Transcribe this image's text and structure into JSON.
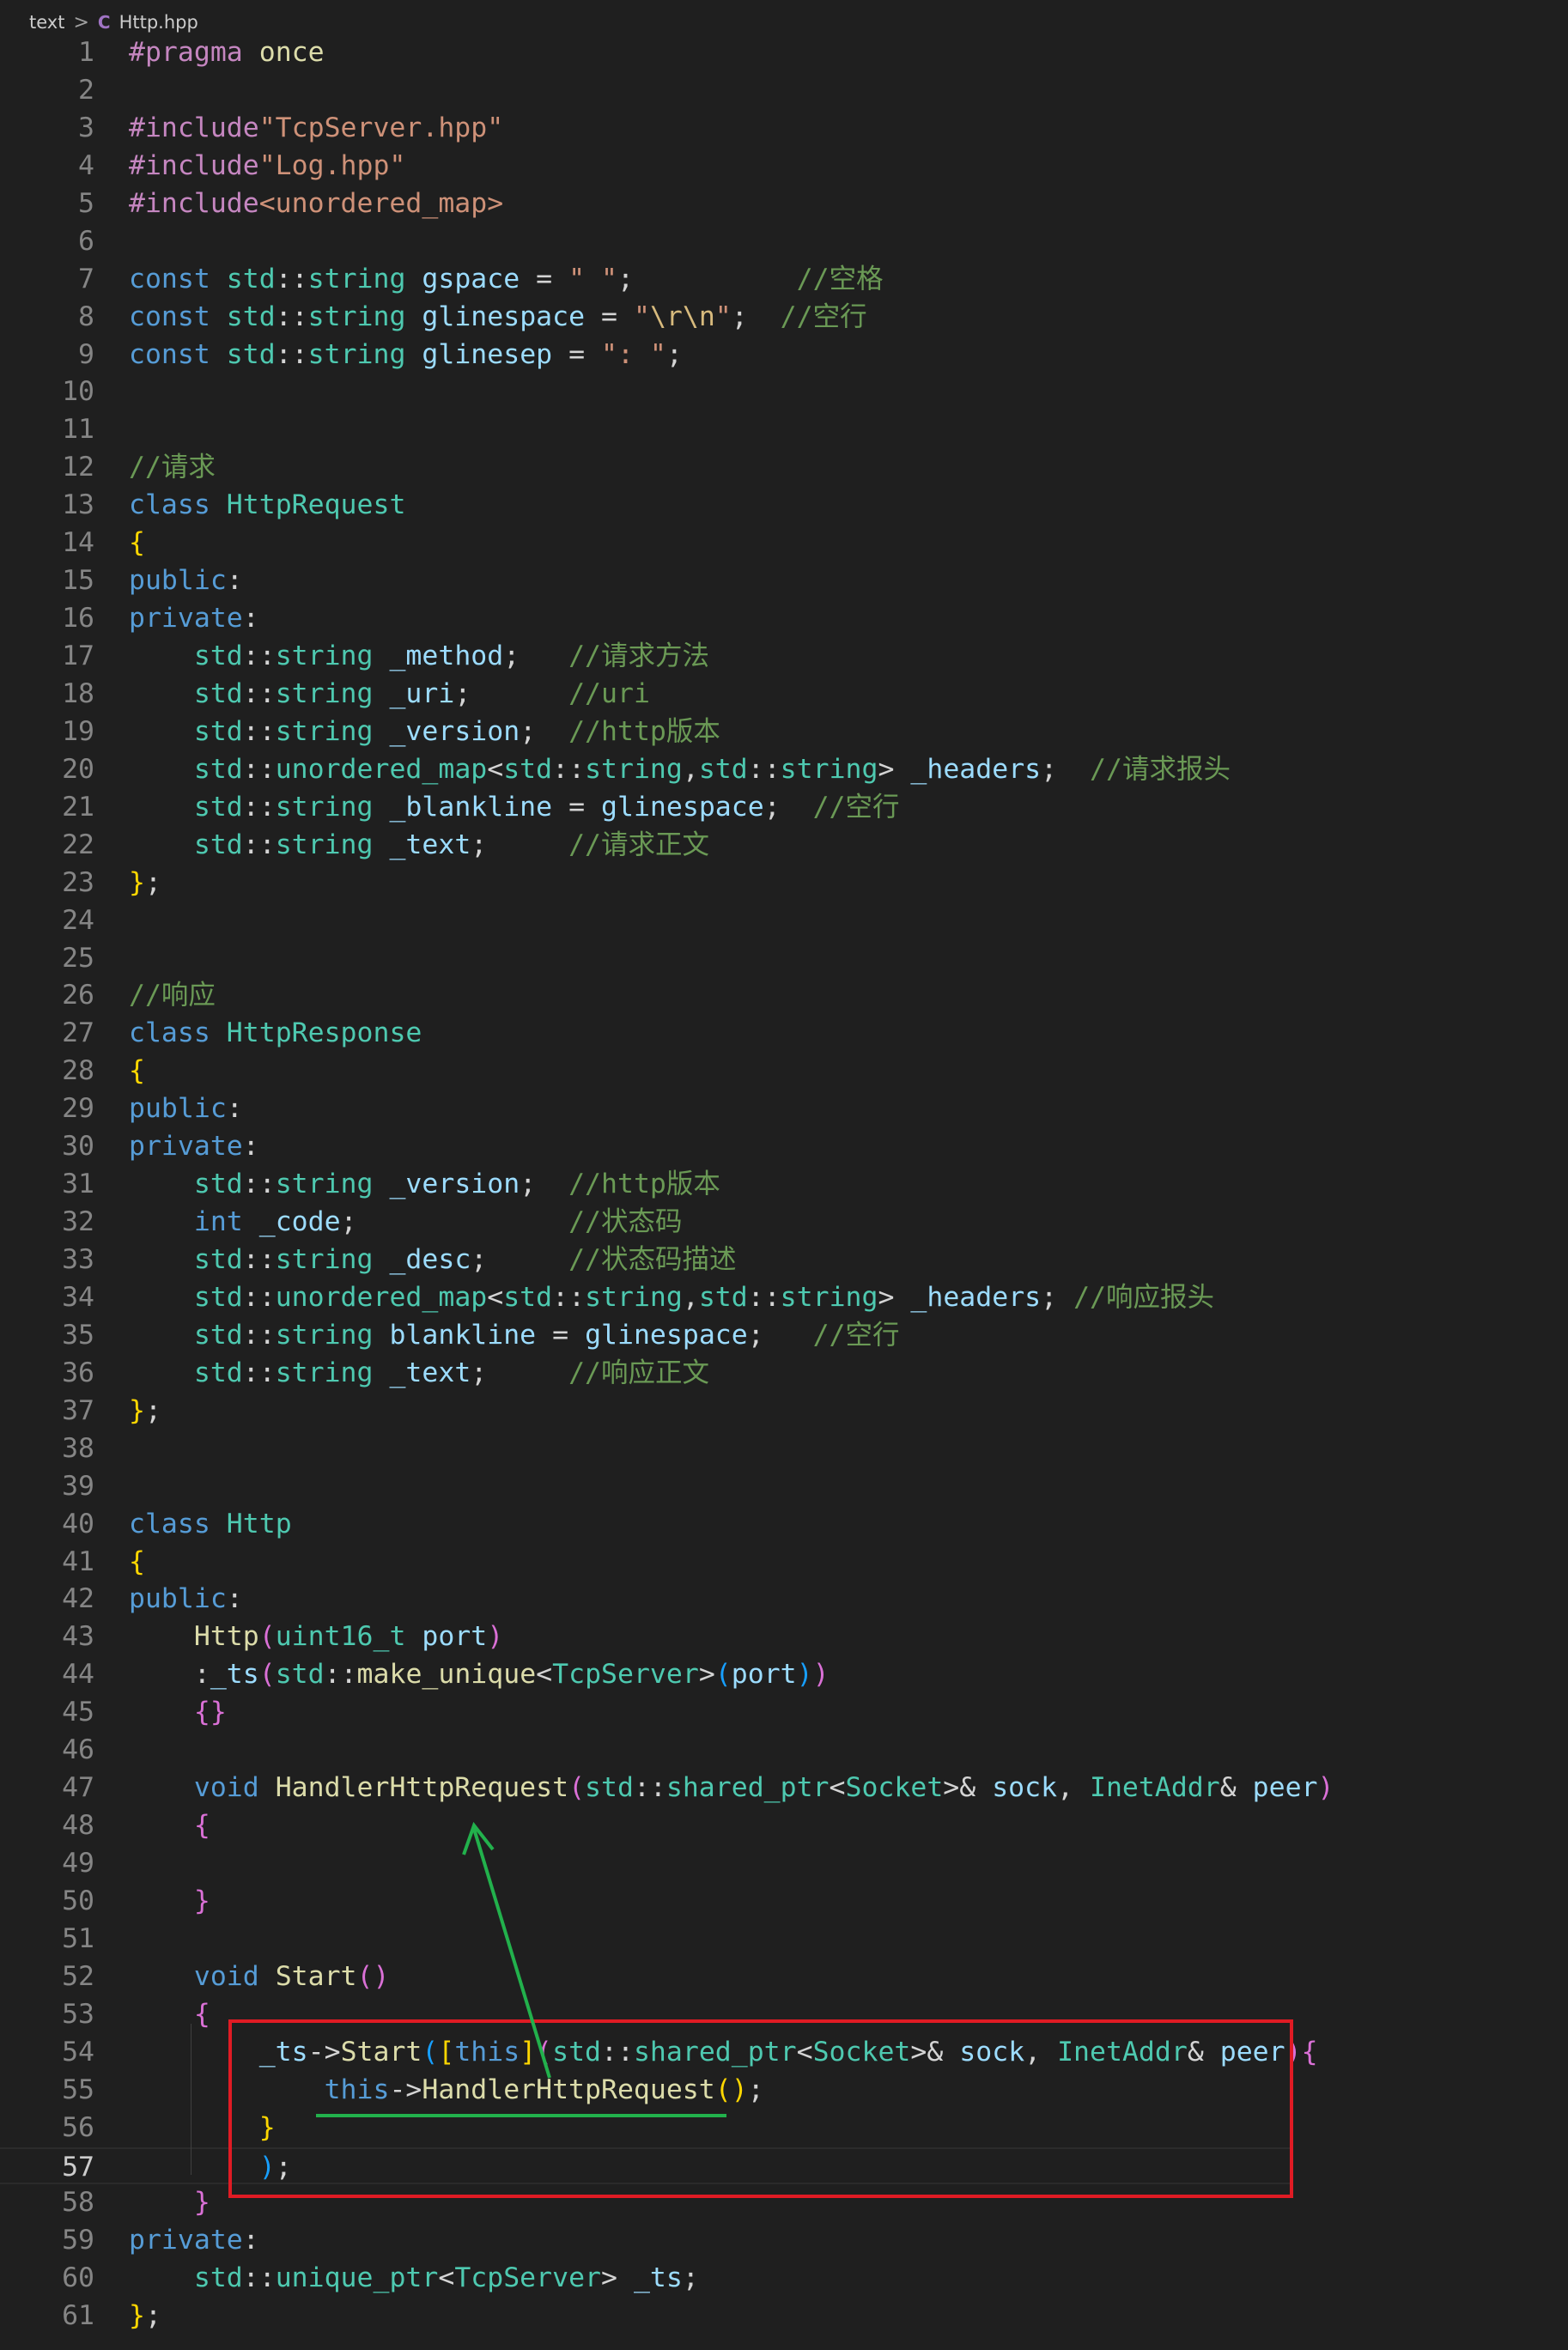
{
  "breadcrumb": {
    "folder": "text",
    "separator": ">",
    "file": "Http.hpp",
    "file_icon": "cpp-file-icon"
  },
  "editor": {
    "active_line": 57,
    "highlight_lines": [
      54,
      57
    ],
    "arrow": {
      "from_line": 55,
      "to_line": 47,
      "color": "#22b14c"
    },
    "box_color": "#e01b24"
  },
  "lines": [
    [
      [
        "pp",
        "#pragma"
      ],
      [
        "pl",
        " "
      ],
      [
        "fn",
        "once"
      ]
    ],
    [],
    [
      [
        "pp",
        "#include"
      ],
      [
        "str",
        "\"TcpServer.hpp\""
      ]
    ],
    [
      [
        "pp",
        "#include"
      ],
      [
        "str",
        "\"Log.hpp\""
      ]
    ],
    [
      [
        "pp",
        "#include"
      ],
      [
        "str",
        "<unordered_map>"
      ]
    ],
    [],
    [
      [
        "kw",
        "const"
      ],
      [
        "pl",
        " "
      ],
      [
        "ty",
        "std"
      ],
      [
        "pl",
        "::"
      ],
      [
        "ty",
        "string"
      ],
      [
        "pl",
        " "
      ],
      [
        "var",
        "gspace"
      ],
      [
        "pl",
        " = "
      ],
      [
        "str",
        "\" \""
      ],
      [
        "pl",
        ";          "
      ],
      [
        "cm",
        "//空格"
      ]
    ],
    [
      [
        "kw",
        "const"
      ],
      [
        "pl",
        " "
      ],
      [
        "ty",
        "std"
      ],
      [
        "pl",
        "::"
      ],
      [
        "ty",
        "string"
      ],
      [
        "pl",
        " "
      ],
      [
        "var",
        "glinespace"
      ],
      [
        "pl",
        " = "
      ],
      [
        "str",
        "\""
      ],
      [
        "esc",
        "\\r\\n"
      ],
      [
        "str",
        "\""
      ],
      [
        "pl",
        ";  "
      ],
      [
        "cm",
        "//空行"
      ]
    ],
    [
      [
        "kw",
        "const"
      ],
      [
        "pl",
        " "
      ],
      [
        "ty",
        "std"
      ],
      [
        "pl",
        "::"
      ],
      [
        "ty",
        "string"
      ],
      [
        "pl",
        " "
      ],
      [
        "var",
        "glinesep"
      ],
      [
        "pl",
        " = "
      ],
      [
        "str",
        "\": \""
      ],
      [
        "pl",
        ";"
      ]
    ],
    [],
    [],
    [
      [
        "cm",
        "//请求"
      ]
    ],
    [
      [
        "kw",
        "class"
      ],
      [
        "pl",
        " "
      ],
      [
        "ty",
        "HttpRequest"
      ]
    ],
    [
      [
        "b1",
        "{"
      ]
    ],
    [
      [
        "kw",
        "public"
      ],
      [
        "pl",
        ":"
      ]
    ],
    [
      [
        "kw",
        "private"
      ],
      [
        "pl",
        ":"
      ]
    ],
    [
      [
        "pl",
        "    "
      ],
      [
        "ty",
        "std"
      ],
      [
        "pl",
        "::"
      ],
      [
        "ty",
        "string"
      ],
      [
        "pl",
        " "
      ],
      [
        "var",
        "_method"
      ],
      [
        "pl",
        ";   "
      ],
      [
        "cm",
        "//请求方法"
      ]
    ],
    [
      [
        "pl",
        "    "
      ],
      [
        "ty",
        "std"
      ],
      [
        "pl",
        "::"
      ],
      [
        "ty",
        "string"
      ],
      [
        "pl",
        " "
      ],
      [
        "var",
        "_uri"
      ],
      [
        "pl",
        ";      "
      ],
      [
        "cm",
        "//uri"
      ]
    ],
    [
      [
        "pl",
        "    "
      ],
      [
        "ty",
        "std"
      ],
      [
        "pl",
        "::"
      ],
      [
        "ty",
        "string"
      ],
      [
        "pl",
        " "
      ],
      [
        "var",
        "_version"
      ],
      [
        "pl",
        ";  "
      ],
      [
        "cm",
        "//http版本"
      ]
    ],
    [
      [
        "pl",
        "    "
      ],
      [
        "ty",
        "std"
      ],
      [
        "pl",
        "::"
      ],
      [
        "ty",
        "unordered_map"
      ],
      [
        "pl",
        "<"
      ],
      [
        "ty",
        "std"
      ],
      [
        "pl",
        "::"
      ],
      [
        "ty",
        "string"
      ],
      [
        "pl",
        ","
      ],
      [
        "ty",
        "std"
      ],
      [
        "pl",
        "::"
      ],
      [
        "ty",
        "string"
      ],
      [
        "pl",
        "> "
      ],
      [
        "var",
        "_headers"
      ],
      [
        "pl",
        ";  "
      ],
      [
        "cm",
        "//请求报头"
      ]
    ],
    [
      [
        "pl",
        "    "
      ],
      [
        "ty",
        "std"
      ],
      [
        "pl",
        "::"
      ],
      [
        "ty",
        "string"
      ],
      [
        "pl",
        " "
      ],
      [
        "var",
        "_blankline"
      ],
      [
        "pl",
        " = "
      ],
      [
        "var",
        "glinespace"
      ],
      [
        "pl",
        ";  "
      ],
      [
        "cm",
        "//空行"
      ]
    ],
    [
      [
        "pl",
        "    "
      ],
      [
        "ty",
        "std"
      ],
      [
        "pl",
        "::"
      ],
      [
        "ty",
        "string"
      ],
      [
        "pl",
        " "
      ],
      [
        "var",
        "_text"
      ],
      [
        "pl",
        ";     "
      ],
      [
        "cm",
        "//请求正文"
      ]
    ],
    [
      [
        "b1",
        "}"
      ],
      [
        "pl",
        ";"
      ]
    ],
    [],
    [],
    [
      [
        "cm",
        "//响应"
      ]
    ],
    [
      [
        "kw",
        "class"
      ],
      [
        "pl",
        " "
      ],
      [
        "ty",
        "HttpResponse"
      ]
    ],
    [
      [
        "b1",
        "{"
      ]
    ],
    [
      [
        "kw",
        "public"
      ],
      [
        "pl",
        ":"
      ]
    ],
    [
      [
        "kw",
        "private"
      ],
      [
        "pl",
        ":"
      ]
    ],
    [
      [
        "pl",
        "    "
      ],
      [
        "ty",
        "std"
      ],
      [
        "pl",
        "::"
      ],
      [
        "ty",
        "string"
      ],
      [
        "pl",
        " "
      ],
      [
        "var",
        "_version"
      ],
      [
        "pl",
        ";  "
      ],
      [
        "cm",
        "//http版本"
      ]
    ],
    [
      [
        "pl",
        "    "
      ],
      [
        "kw",
        "int"
      ],
      [
        "pl",
        " "
      ],
      [
        "var",
        "_code"
      ],
      [
        "pl",
        ";             "
      ],
      [
        "cm",
        "//状态码"
      ]
    ],
    [
      [
        "pl",
        "    "
      ],
      [
        "ty",
        "std"
      ],
      [
        "pl",
        "::"
      ],
      [
        "ty",
        "string"
      ],
      [
        "pl",
        " "
      ],
      [
        "var",
        "_desc"
      ],
      [
        "pl",
        ";     "
      ],
      [
        "cm",
        "//状态码描述"
      ]
    ],
    [
      [
        "pl",
        "    "
      ],
      [
        "ty",
        "std"
      ],
      [
        "pl",
        "::"
      ],
      [
        "ty",
        "unordered_map"
      ],
      [
        "pl",
        "<"
      ],
      [
        "ty",
        "std"
      ],
      [
        "pl",
        "::"
      ],
      [
        "ty",
        "string"
      ],
      [
        "pl",
        ","
      ],
      [
        "ty",
        "std"
      ],
      [
        "pl",
        "::"
      ],
      [
        "ty",
        "string"
      ],
      [
        "pl",
        "> "
      ],
      [
        "var",
        "_headers"
      ],
      [
        "pl",
        "; "
      ],
      [
        "cm",
        "//响应报头"
      ]
    ],
    [
      [
        "pl",
        "    "
      ],
      [
        "ty",
        "std"
      ],
      [
        "pl",
        "::"
      ],
      [
        "ty",
        "string"
      ],
      [
        "pl",
        " "
      ],
      [
        "var",
        "blankline"
      ],
      [
        "pl",
        " = "
      ],
      [
        "var",
        "glinespace"
      ],
      [
        "pl",
        ";   "
      ],
      [
        "cm",
        "//空行"
      ]
    ],
    [
      [
        "pl",
        "    "
      ],
      [
        "ty",
        "std"
      ],
      [
        "pl",
        "::"
      ],
      [
        "ty",
        "string"
      ],
      [
        "pl",
        " "
      ],
      [
        "var",
        "_text"
      ],
      [
        "pl",
        ";     "
      ],
      [
        "cm",
        "//响应正文"
      ]
    ],
    [
      [
        "b1",
        "}"
      ],
      [
        "pl",
        ";"
      ]
    ],
    [],
    [],
    [
      [
        "kw",
        "class"
      ],
      [
        "pl",
        " "
      ],
      [
        "ty",
        "Http"
      ]
    ],
    [
      [
        "b1",
        "{"
      ]
    ],
    [
      [
        "kw",
        "public"
      ],
      [
        "pl",
        ":"
      ]
    ],
    [
      [
        "pl",
        "    "
      ],
      [
        "fn",
        "Http"
      ],
      [
        "b2",
        "("
      ],
      [
        "ty",
        "uint16_t"
      ],
      [
        "pl",
        " "
      ],
      [
        "var",
        "port"
      ],
      [
        "b2",
        ")"
      ]
    ],
    [
      [
        "pl",
        "    :"
      ],
      [
        "var",
        "_ts"
      ],
      [
        "b2",
        "("
      ],
      [
        "ty",
        "std"
      ],
      [
        "pl",
        "::"
      ],
      [
        "fn",
        "make_unique"
      ],
      [
        "pl",
        "<"
      ],
      [
        "ty",
        "TcpServer"
      ],
      [
        "pl",
        ">"
      ],
      [
        "b3",
        "("
      ],
      [
        "var",
        "port"
      ],
      [
        "b3",
        ")"
      ],
      [
        "b2",
        ")"
      ]
    ],
    [
      [
        "pl",
        "    "
      ],
      [
        "b2",
        "{}"
      ]
    ],
    [],
    [
      [
        "pl",
        "    "
      ],
      [
        "kw",
        "void"
      ],
      [
        "pl",
        " "
      ],
      [
        "fn",
        "HandlerHttpRequest"
      ],
      [
        "b2",
        "("
      ],
      [
        "ty",
        "std"
      ],
      [
        "pl",
        "::"
      ],
      [
        "ty",
        "shared_ptr"
      ],
      [
        "pl",
        "<"
      ],
      [
        "ty",
        "Socket"
      ],
      [
        "pl",
        ">& "
      ],
      [
        "var",
        "sock"
      ],
      [
        "pl",
        ", "
      ],
      [
        "ty",
        "InetAddr"
      ],
      [
        "pl",
        "& "
      ],
      [
        "var",
        "peer"
      ],
      [
        "b2",
        ")"
      ]
    ],
    [
      [
        "pl",
        "    "
      ],
      [
        "b2",
        "{"
      ]
    ],
    [],
    [
      [
        "pl",
        "    "
      ],
      [
        "b2",
        "}"
      ]
    ],
    [],
    [
      [
        "pl",
        "    "
      ],
      [
        "kw",
        "void"
      ],
      [
        "pl",
        " "
      ],
      [
        "fn",
        "Start"
      ],
      [
        "b2",
        "()"
      ]
    ],
    [
      [
        "pl",
        "    "
      ],
      [
        "b2",
        "{"
      ]
    ],
    [
      [
        "pl",
        "        "
      ],
      [
        "var",
        "_ts"
      ],
      [
        "pl",
        "->"
      ],
      [
        "fn",
        "Start"
      ],
      [
        "b3",
        "("
      ],
      [
        "b1",
        "["
      ],
      [
        "kw",
        "this"
      ],
      [
        "b1",
        "]"
      ],
      [
        "b2",
        "("
      ],
      [
        "ty",
        "std"
      ],
      [
        "pl",
        "::"
      ],
      [
        "ty",
        "shared_ptr"
      ],
      [
        "pl",
        "<"
      ],
      [
        "ty",
        "Socket"
      ],
      [
        "pl",
        ">& "
      ],
      [
        "var",
        "sock"
      ],
      [
        "pl",
        ", "
      ],
      [
        "ty",
        "InetAddr"
      ],
      [
        "pl",
        "& "
      ],
      [
        "var",
        "peer"
      ],
      [
        "b2",
        ")"
      ],
      [
        "b2",
        "{"
      ]
    ],
    [
      [
        "pl",
        "            "
      ],
      [
        "kw",
        "this"
      ],
      [
        "pl",
        "->"
      ],
      [
        "fn",
        "HandlerHttpRequest"
      ],
      [
        "b1",
        "()"
      ],
      [
        "pl",
        ";"
      ]
    ],
    [
      [
        "pl",
        "        "
      ],
      [
        "b1",
        "}"
      ]
    ],
    [
      [
        "pl",
        "        "
      ],
      [
        "b3",
        ")"
      ],
      [
        "pl",
        ";"
      ]
    ],
    [
      [
        "pl",
        "    "
      ],
      [
        "b2",
        "}"
      ]
    ],
    [
      [
        "kw",
        "private"
      ],
      [
        "pl",
        ":"
      ]
    ],
    [
      [
        "pl",
        "    "
      ],
      [
        "ty",
        "std"
      ],
      [
        "pl",
        "::"
      ],
      [
        "ty",
        "unique_ptr"
      ],
      [
        "pl",
        "<"
      ],
      [
        "ty",
        "TcpServer"
      ],
      [
        "pl",
        "> "
      ],
      [
        "var",
        "_ts"
      ],
      [
        "pl",
        ";"
      ]
    ],
    [
      [
        "b1",
        "}"
      ],
      [
        "pl",
        ";"
      ]
    ]
  ]
}
